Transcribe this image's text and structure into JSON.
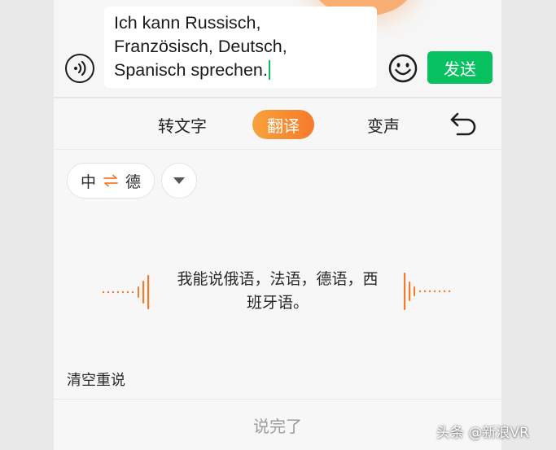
{
  "input": {
    "lines": [
      "Ich kann Russisch,",
      "Französisch, Deutsch,",
      "Spanisch sprechen."
    ]
  },
  "toolbar": {
    "voice_icon": "voice-wave-icon",
    "emoji_icon": "smiley-icon",
    "send_label": "发送"
  },
  "tabs": [
    {
      "label": "转文字",
      "active": false
    },
    {
      "label": "翻译",
      "active": true
    },
    {
      "label": "变声",
      "active": false
    }
  ],
  "undo_icon": "undo-arrow-icon",
  "language": {
    "source": "中",
    "target": "德",
    "swap_icon": "swap-arrows-icon",
    "dropdown_icon": "triangle-down-icon"
  },
  "recognized": {
    "lines": [
      "我能说俄语，法语，德语，西",
      "班牙语。"
    ]
  },
  "actions": {
    "clear_label": "清空重说",
    "done_label": "说完了"
  },
  "watermark": "头条 @新浪VR",
  "colors": {
    "accent_green": "#07c160",
    "accent_orange": "#f57a2c"
  }
}
